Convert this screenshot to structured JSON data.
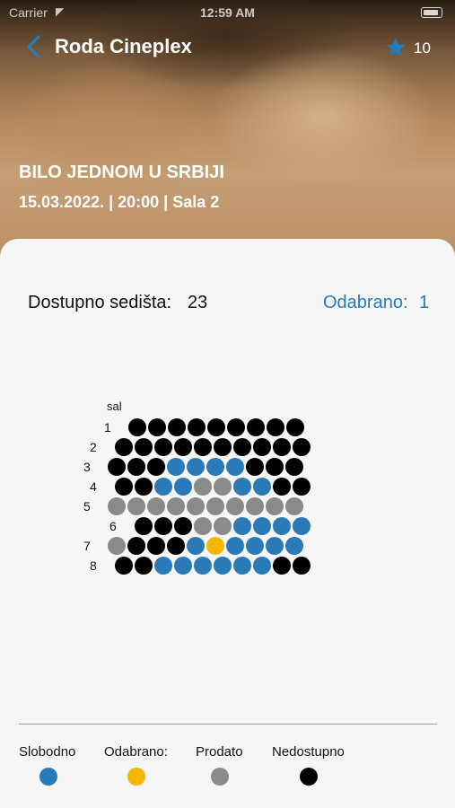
{
  "status_bar": {
    "carrier": "Carrier",
    "time": "12:59 AM"
  },
  "nav": {
    "title": "Roda Cineplex",
    "favorite_count": "10"
  },
  "movie": {
    "title": "BILO JEDNOM U SRBIJI",
    "info": "15.03.2022. | 20:00 | Sala 2"
  },
  "summary": {
    "available_label": "Dostupno sedišta:",
    "available_count": "23",
    "selected_label": "Odabrano:",
    "selected_count": "1"
  },
  "seat_map": {
    "hall_label": "sal",
    "rows": [
      {
        "label": "1",
        "seats": [
          "unavailable",
          "unavailable",
          "unavailable",
          "unavailable",
          "unavailable",
          "unavailable",
          "unavailable",
          "unavailable",
          "unavailable"
        ]
      },
      {
        "label": "2",
        "seats": [
          "unavailable",
          "unavailable",
          "unavailable",
          "unavailable",
          "unavailable",
          "unavailable",
          "unavailable",
          "unavailable",
          "unavailable",
          "unavailable"
        ]
      },
      {
        "label": "3",
        "seats": [
          "unavailable",
          "unavailable",
          "unavailable",
          "free",
          "free",
          "free",
          "free",
          "unavailable",
          "unavailable",
          "unavailable"
        ]
      },
      {
        "label": "4",
        "seats": [
          "unavailable",
          "unavailable",
          "free",
          "free",
          "sold",
          "sold",
          "free",
          "free",
          "unavailable",
          "unavailable"
        ]
      },
      {
        "label": "5",
        "seats": [
          "sold",
          "sold",
          "sold",
          "sold",
          "sold",
          "sold",
          "sold",
          "sold",
          "sold",
          "sold"
        ]
      },
      {
        "label": "6",
        "seats": [
          "unavailable",
          "unavailable",
          "unavailable",
          "sold",
          "sold",
          "free",
          "free",
          "free",
          "free"
        ]
      },
      {
        "label": "7",
        "seats": [
          "sold",
          "unavailable",
          "unavailable",
          "unavailable",
          "free",
          "selected",
          "free",
          "free",
          "free",
          "free"
        ]
      },
      {
        "label": "8",
        "seats": [
          "unavailable",
          "unavailable",
          "free",
          "free",
          "free",
          "free",
          "free",
          "free",
          "unavailable",
          "unavailable"
        ]
      }
    ]
  },
  "legend": [
    {
      "label": "Slobodno",
      "color": "#2a7ab8"
    },
    {
      "label": "Odabrano:",
      "color": "#f5b700"
    },
    {
      "label": "Prodato",
      "color": "#8a8a8a"
    },
    {
      "label": "Nedostupno",
      "color": "#000000"
    }
  ]
}
